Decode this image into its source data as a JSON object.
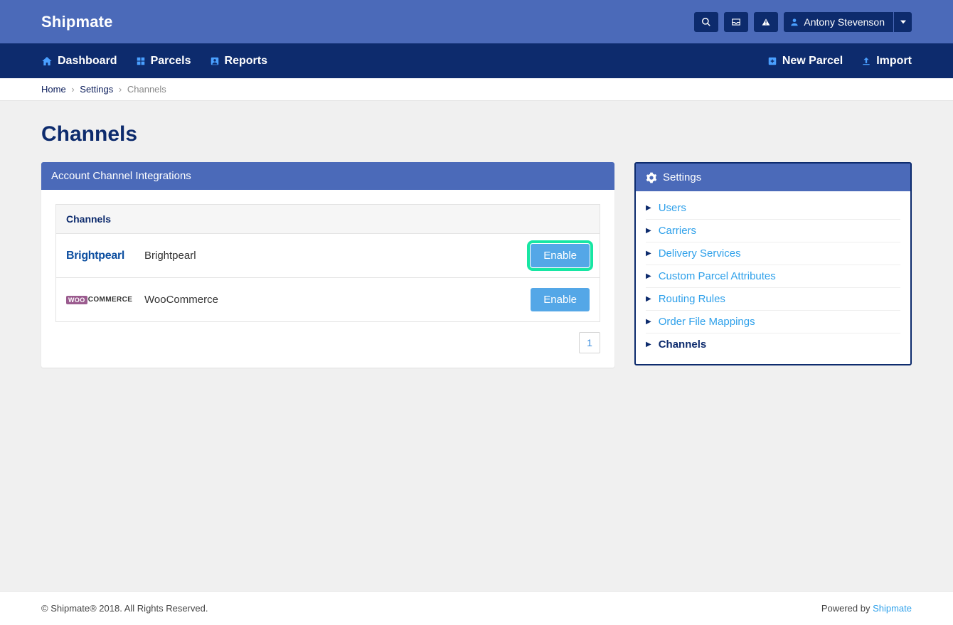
{
  "brand": "Shipmate",
  "user": {
    "name": "Antony Stevenson"
  },
  "nav": {
    "dashboard": "Dashboard",
    "parcels": "Parcels",
    "reports": "Reports",
    "new_parcel": "New Parcel",
    "import": "Import"
  },
  "breadcrumb": {
    "home": "Home",
    "settings": "Settings",
    "current": "Channels"
  },
  "page_title": "Channels",
  "main_panel_title": "Account Channel Integrations",
  "table": {
    "header": "Channels",
    "rows": [
      {
        "logo_text": "Brightpearl",
        "name": "Brightpearl",
        "action": "Enable",
        "highlight": true
      },
      {
        "logo_text": "WOO COMMERCE",
        "name": "WooCommerce",
        "action": "Enable",
        "highlight": false
      }
    ]
  },
  "pagination": {
    "page": "1"
  },
  "settings_panel": {
    "title": "Settings",
    "items": [
      {
        "label": "Users",
        "active": false
      },
      {
        "label": "Carriers",
        "active": false
      },
      {
        "label": "Delivery Services",
        "active": false
      },
      {
        "label": "Custom Parcel Attributes",
        "active": false
      },
      {
        "label": "Routing Rules",
        "active": false
      },
      {
        "label": "Order File Mappings",
        "active": false
      },
      {
        "label": "Channels",
        "active": true
      }
    ]
  },
  "footer": {
    "copyright": "© Shipmate® 2018. All Rights Reserved.",
    "powered_by": "Powered by ",
    "powered_link": "Shipmate"
  }
}
